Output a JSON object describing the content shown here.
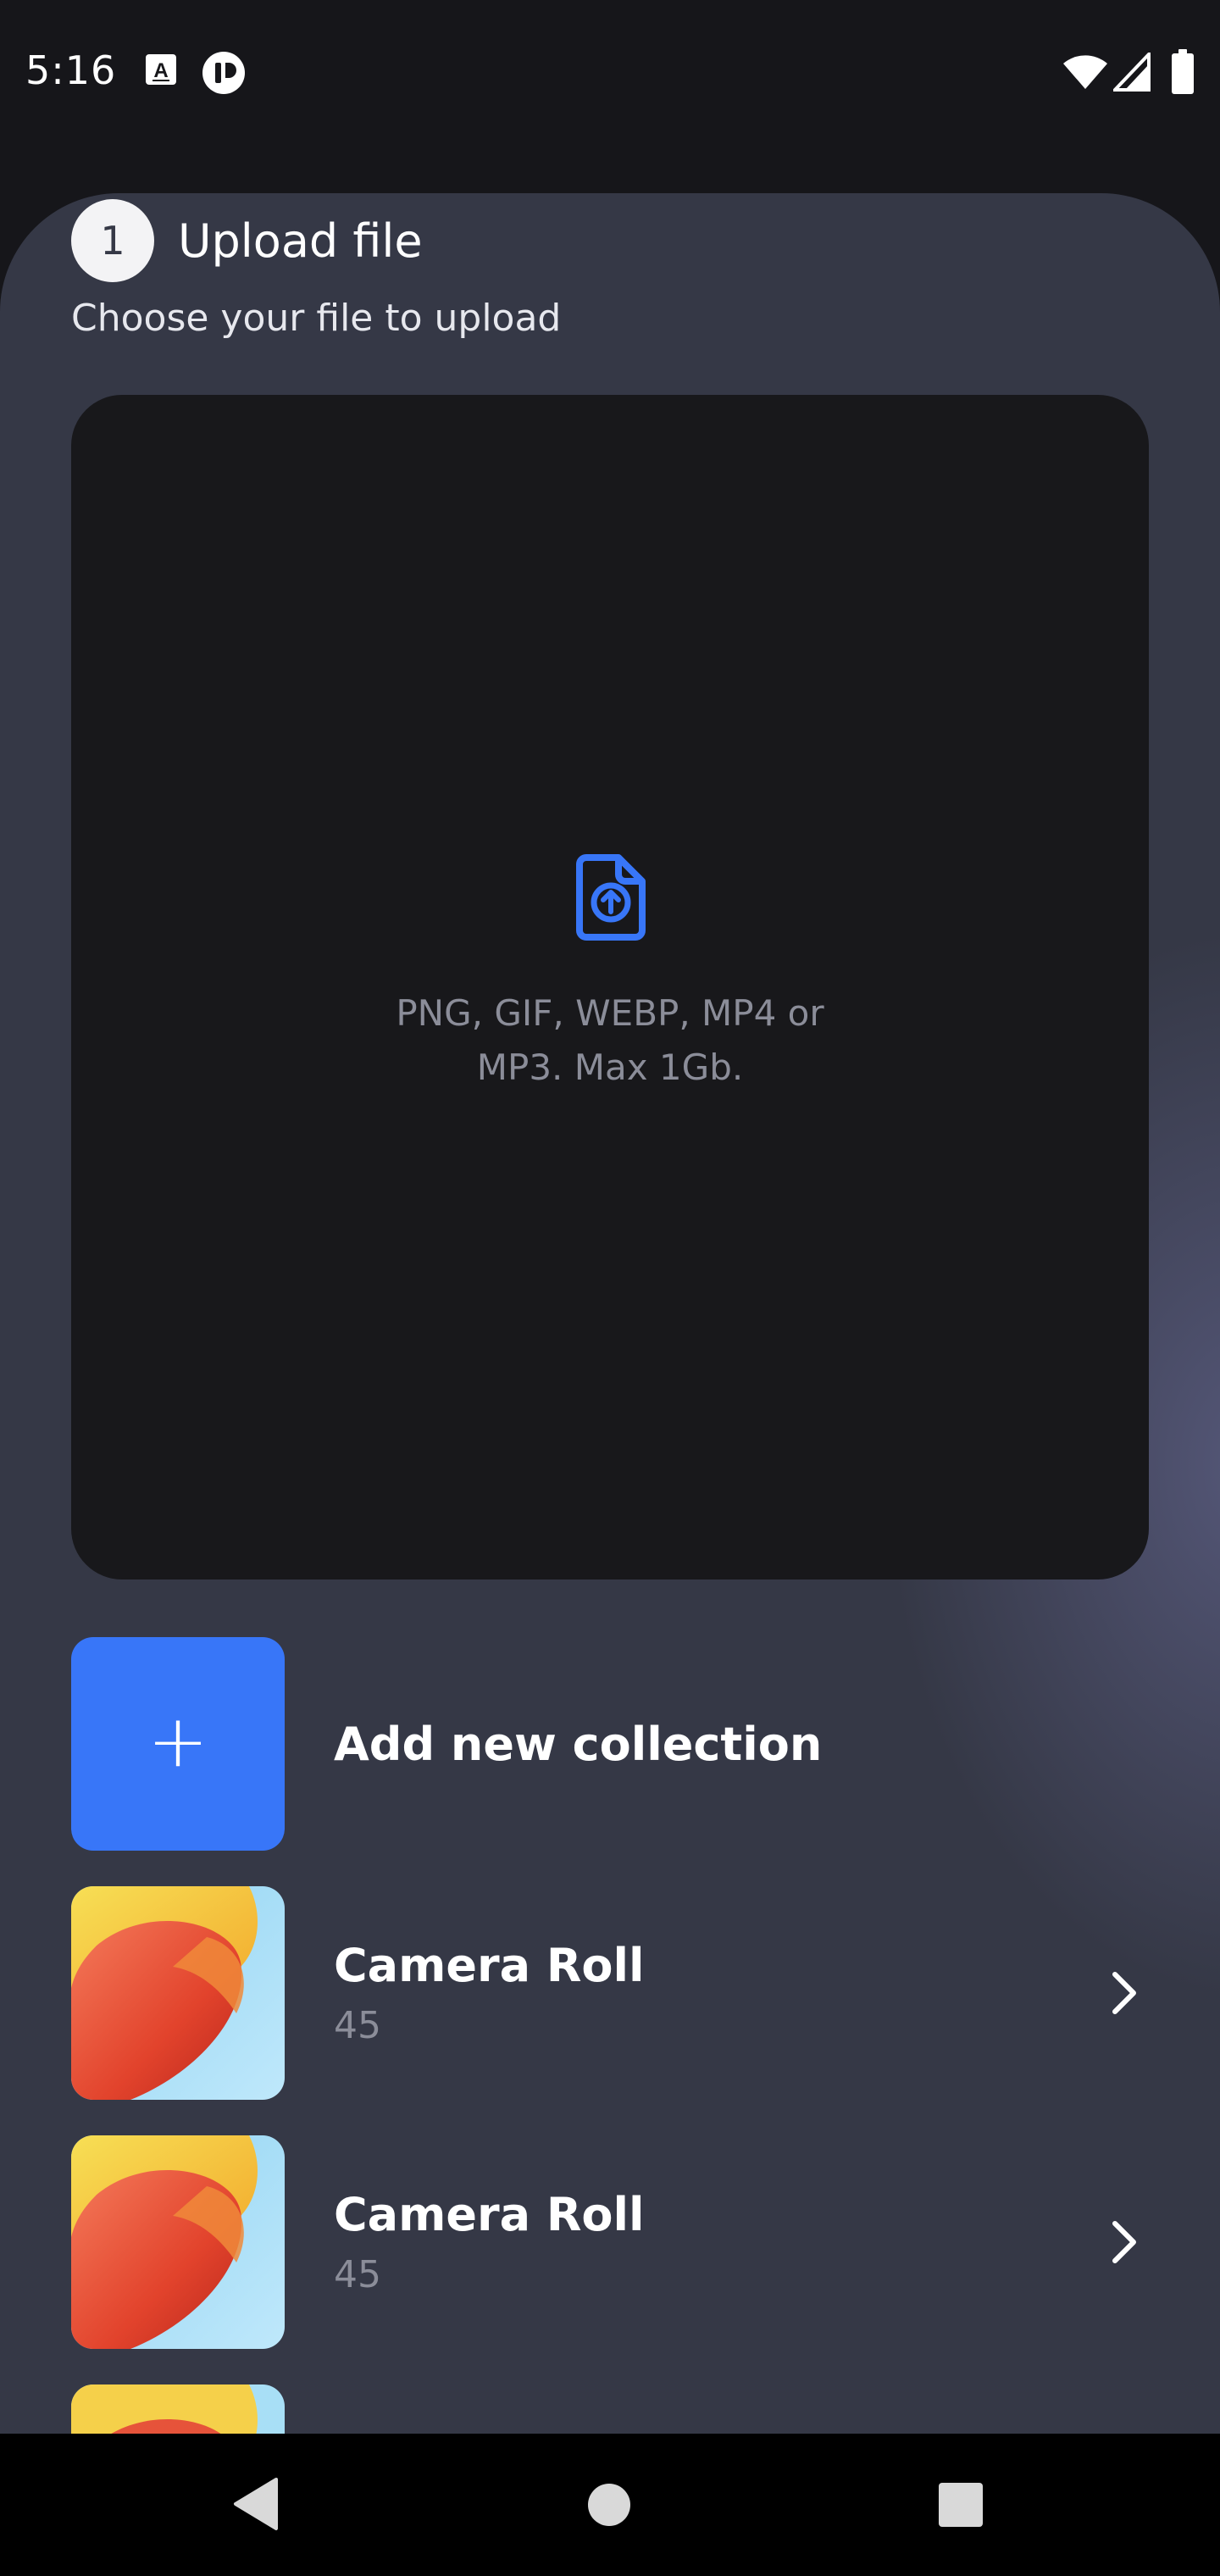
{
  "status_bar": {
    "time": "5:16",
    "icons": [
      "a-keyboard-icon",
      "app-notification-icon",
      "wifi-icon",
      "cell-signal-icon",
      "battery-icon"
    ]
  },
  "upload_section": {
    "step_number": "1",
    "title": "Upload file",
    "subtitle": "Choose your file to upload",
    "dropzone_text": "PNG, GIF, WEBP, MP4 or MP3. Max 1Gb.",
    "icon": "file-upload-icon",
    "accent_color": "#3876f8"
  },
  "collections": {
    "add_label": "Add new collection",
    "items": [
      {
        "title": "Camera Roll",
        "count": "45"
      },
      {
        "title": "Camera Roll",
        "count": "45"
      }
    ]
  },
  "nav_bar": {
    "buttons": [
      "back-icon",
      "home-icon",
      "recents-icon"
    ]
  }
}
